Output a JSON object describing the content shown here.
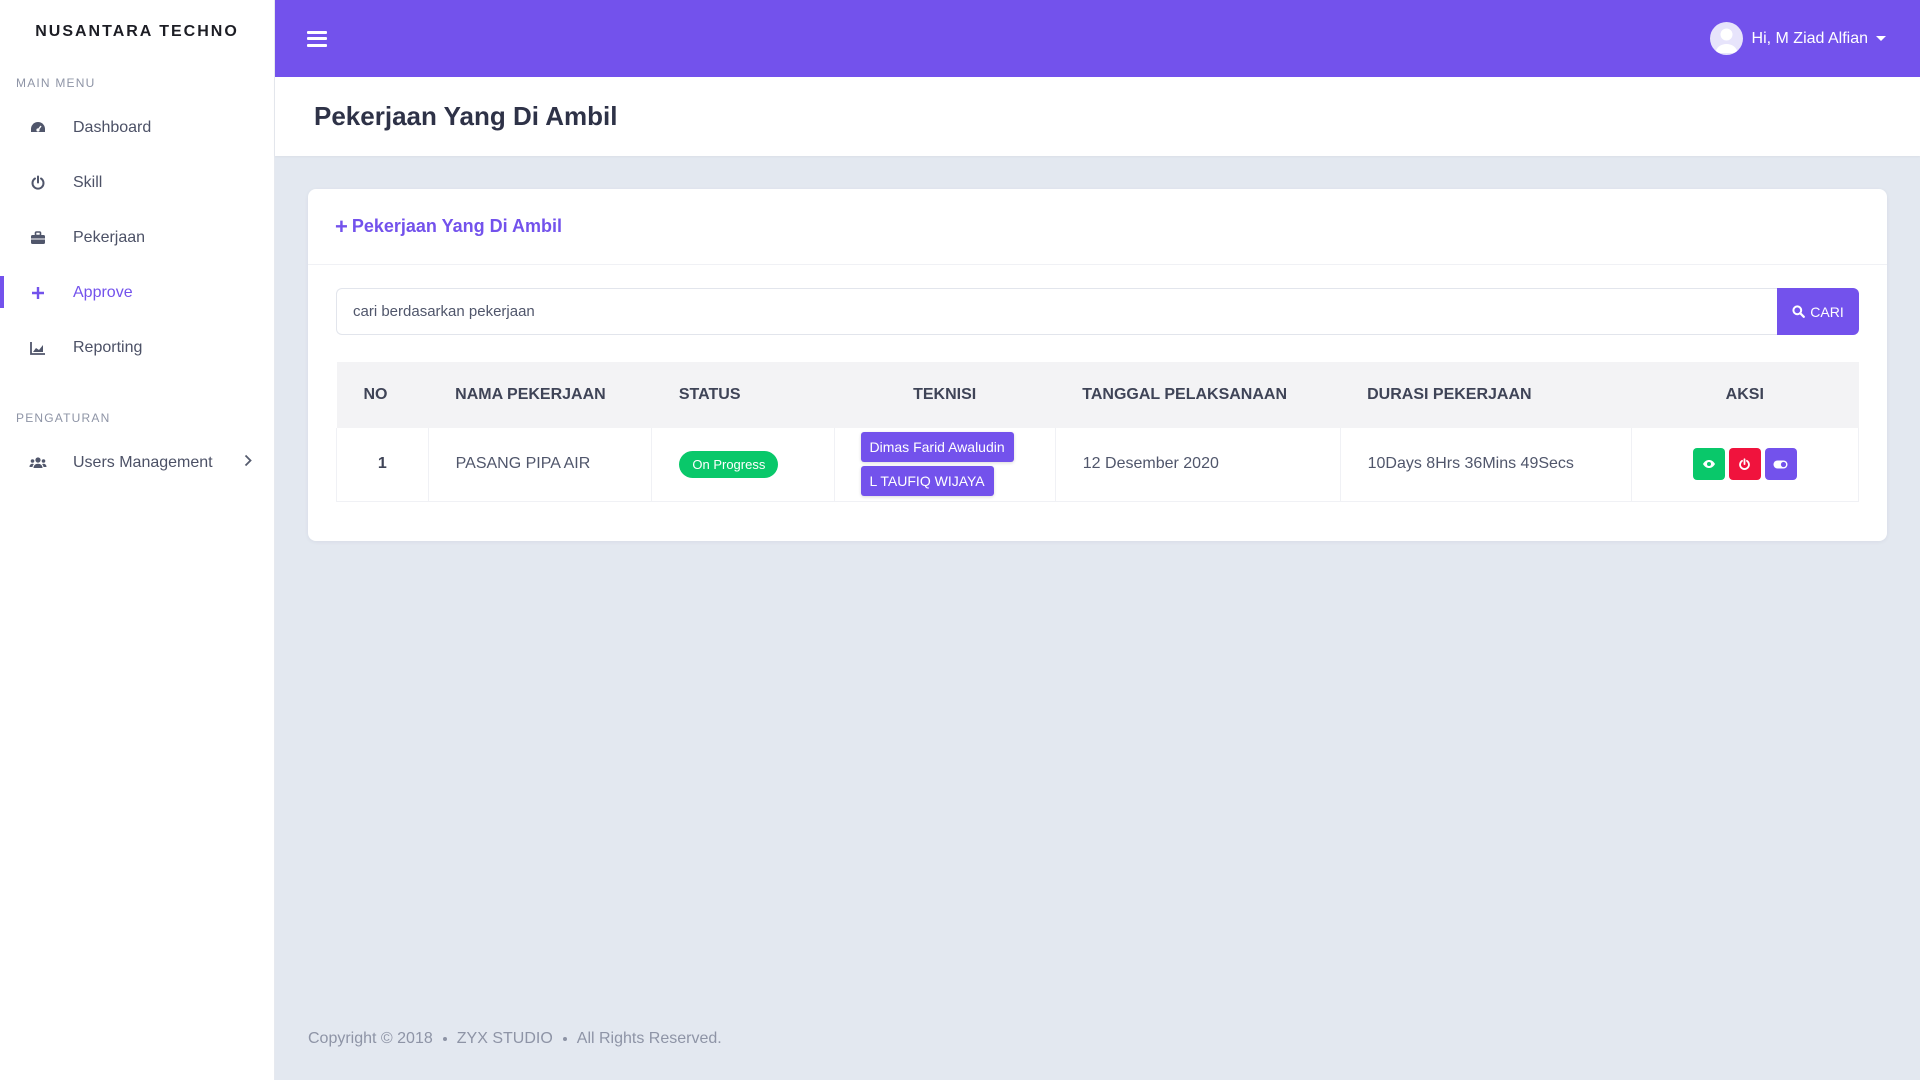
{
  "sidebar": {
    "brand": "NUSANTARA TECHNO",
    "main_menu_label": "MAIN MENU",
    "items": [
      {
        "label": "Dashboard",
        "icon": "dashboard-icon"
      },
      {
        "label": "Skill",
        "icon": "power-icon"
      },
      {
        "label": "Pekerjaan",
        "icon": "briefcase-icon"
      },
      {
        "label": "Approve",
        "icon": "plus-icon",
        "active": true
      },
      {
        "label": "Reporting",
        "icon": "chart-icon"
      }
    ],
    "settings_label": "PENGATURAN",
    "settings_items": [
      {
        "label": "Users Management",
        "icon": "users-icon"
      }
    ]
  },
  "topbar": {
    "user_greeting": "Hi, M Ziad Alfian"
  },
  "page": {
    "title": "Pekerjaan Yang Di Ambil"
  },
  "card": {
    "header": "Pekerjaan Yang Di Ambil",
    "search": {
      "placeholder": "cari berdasarkan pekerjaan",
      "button": "CARI"
    },
    "table": {
      "columns": [
        "NO",
        "NAMA PEKERJAAN",
        "STATUS",
        "TEKNISI",
        "TANGGAL PELAKSANAAN",
        "DURASI PEKERJAAN",
        "AKSI"
      ],
      "rows": [
        {
          "no": "1",
          "nama": "PASANG PIPA AIR",
          "status": "On Progress",
          "teknisi": [
            "Dimas Farid Awaludin",
            "L TAUFIQ WIJAYA"
          ],
          "tanggal": "12 Desember 2020",
          "durasi": "10Days 8Hrs 36Mins 49Secs"
        }
      ]
    }
  },
  "footer": {
    "copyright": "Copyright © 2018",
    "studio": "ZYX STUDIO",
    "rights": "All Rights Reserved."
  },
  "colors": {
    "accent": "#7352ec",
    "success": "#09c86a",
    "danger": "#f0133d",
    "background": "#e3e8f0"
  }
}
